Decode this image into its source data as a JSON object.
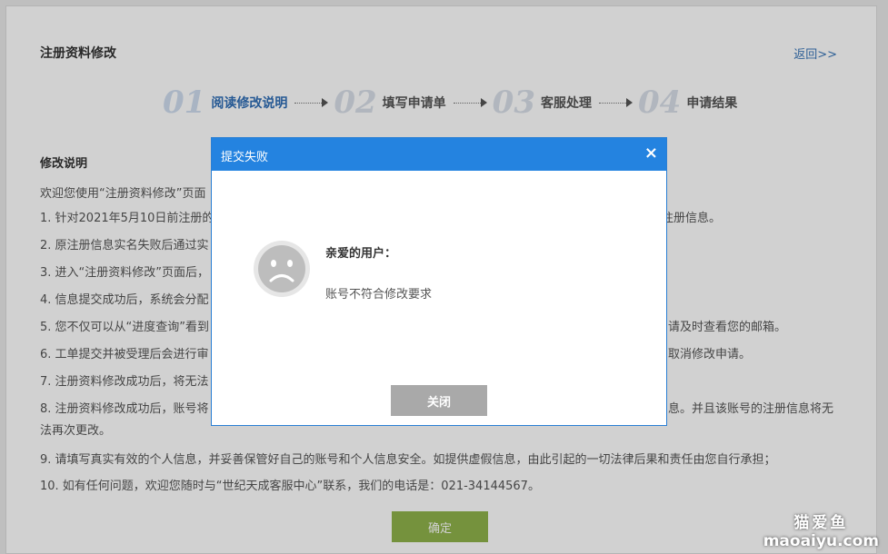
{
  "page": {
    "title": "注册资料修改",
    "back_link": "返回>>"
  },
  "steps": [
    {
      "num": "01",
      "label": "阅读修改说明",
      "active": true
    },
    {
      "num": "02",
      "label": "填写申请单",
      "active": false
    },
    {
      "num": "03",
      "label": "客服处理",
      "active": false
    },
    {
      "num": "04",
      "label": "申请结果",
      "active": false
    }
  ],
  "instructions": {
    "title": "修改说明",
    "intro": "欢迎您使用“注册资料修改”页面",
    "items": [
      "1. 针对2021年5月10日前注册的",
      "2. 原注册信息实名失败后通过实",
      "3. 进入“注册资料修改”页面后，",
      "4. 信息提交成功后，系统会分配",
      "5. 您不仅可以从“进度查询”看到",
      "6. 工单提交并被受理后会进行审",
      "7. 注册资料修改成功后，将无法",
      "8. 注册资料修改成功后，账号将",
      "9. 请填写真实有效的个人信息，并妥善保管好自己的账号和个人信息安全。如提供虚假信息，由此引起的一切法律后果和责任由您自行承担；",
      "10. 如有任何问题，欢迎您随时与“世纪天成客服中心”联系，我们的电话是：021-34144567。"
    ],
    "tails": [
      {
        "line": 1,
        "text": "注册信息。"
      },
      {
        "line": 5,
        "text": "请及时查看您的邮箱。"
      },
      {
        "line": 6,
        "text": "取消修改申请。"
      },
      {
        "line": 8,
        "text": "息。并且该账号的注册信息将无"
      }
    ],
    "continuation": "法再次更改。",
    "confirm_label": "确定"
  },
  "dialog": {
    "title": "提交失败",
    "close_symbol": "×",
    "greeting": "亲爱的用户：",
    "message": "账号不符合修改要求",
    "close_label": "关闭",
    "header_color": "#2483e0",
    "icon": "sad-face-icon"
  },
  "watermark": {
    "cn": "猫爱鱼",
    "en": "maoaiyu.com"
  }
}
